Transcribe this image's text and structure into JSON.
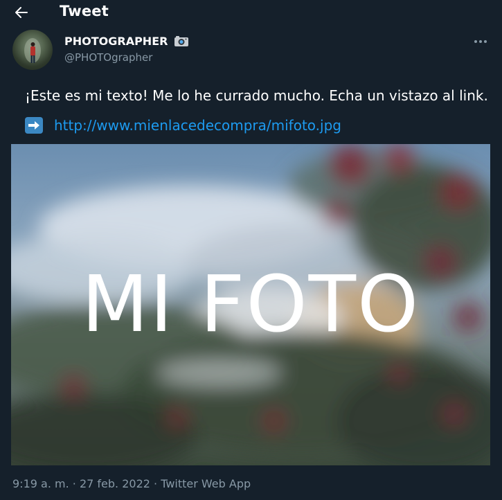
{
  "header": {
    "title": "Tweet",
    "back_icon": "arrow-left-icon"
  },
  "tweet": {
    "author_name": "PHOTOGRAPHER",
    "author_emoji": "camera-emoji-icon",
    "author_handle": "@PHOTOgrapher",
    "text": "¡Este es mi texto! Me lo he currado mucho. Echa un vistazo al link.",
    "link_emoji": "right-arrow-emoji-icon",
    "link": "http://www.mienlacedecompra/mifoto.jpg",
    "photo_overlay_text": "MI FOTO",
    "time": "9:19 a. m.",
    "separator": "·",
    "date": "27 feb. 2022",
    "source": "Twitter Web App"
  },
  "colors": {
    "background": "#15202b",
    "link": "#1d9bf0",
    "secondary_text": "#8899a6",
    "primary_text": "#ffffff"
  }
}
